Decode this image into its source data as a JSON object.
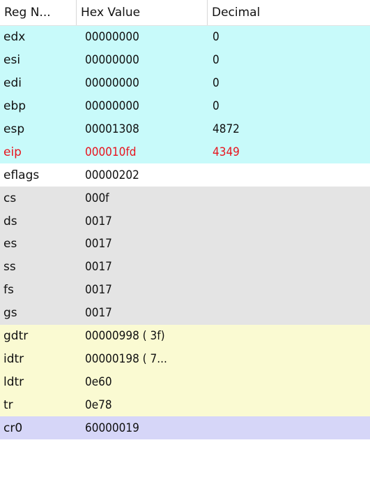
{
  "colors": {
    "general": "#c8fafa",
    "flags": "#ffffff",
    "segment": "#e4e4e4",
    "descriptor": "#fafad2",
    "control": "#d6d6f8",
    "text_default": "#111111",
    "text_changed": "#e8141e"
  },
  "header": {
    "name": "Reg N...",
    "hex": "Hex Value",
    "decimal": "Decimal"
  },
  "registers": [
    {
      "name": "edx",
      "hex": "00000000",
      "decimal": "0",
      "group": "general",
      "changed": false
    },
    {
      "name": "esi",
      "hex": "00000000",
      "decimal": "0",
      "group": "general",
      "changed": false
    },
    {
      "name": "edi",
      "hex": "00000000",
      "decimal": "0",
      "group": "general",
      "changed": false
    },
    {
      "name": "ebp",
      "hex": "00000000",
      "decimal": "0",
      "group": "general",
      "changed": false
    },
    {
      "name": "esp",
      "hex": "00001308",
      "decimal": "4872",
      "group": "general",
      "changed": false
    },
    {
      "name": "eip",
      "hex": "000010fd",
      "decimal": "4349",
      "group": "general",
      "changed": true
    },
    {
      "name": "eflags",
      "hex": "00000202",
      "decimal": "",
      "group": "flags",
      "changed": false
    },
    {
      "name": "cs",
      "hex": "000f",
      "decimal": "",
      "group": "segment",
      "changed": false
    },
    {
      "name": "ds",
      "hex": "0017",
      "decimal": "",
      "group": "segment",
      "changed": false
    },
    {
      "name": "es",
      "hex": "0017",
      "decimal": "",
      "group": "segment",
      "changed": false
    },
    {
      "name": "ss",
      "hex": "0017",
      "decimal": "",
      "group": "segment",
      "changed": false
    },
    {
      "name": "fs",
      "hex": "0017",
      "decimal": "",
      "group": "segment",
      "changed": false
    },
    {
      "name": "gs",
      "hex": "0017",
      "decimal": "",
      "group": "segment",
      "changed": false
    },
    {
      "name": "gdtr",
      "hex": "00000998 (  3f)",
      "decimal": "",
      "group": "descriptor",
      "changed": false
    },
    {
      "name": "idtr",
      "hex": "00000198 ( 7...",
      "decimal": "",
      "group": "descriptor",
      "changed": false
    },
    {
      "name": "ldtr",
      "hex": "0e60",
      "decimal": "",
      "group": "descriptor",
      "changed": false
    },
    {
      "name": "tr",
      "hex": "0e78",
      "decimal": "",
      "group": "descriptor",
      "changed": false
    },
    {
      "name": "cr0",
      "hex": "60000019",
      "decimal": "",
      "group": "control",
      "changed": false
    }
  ]
}
